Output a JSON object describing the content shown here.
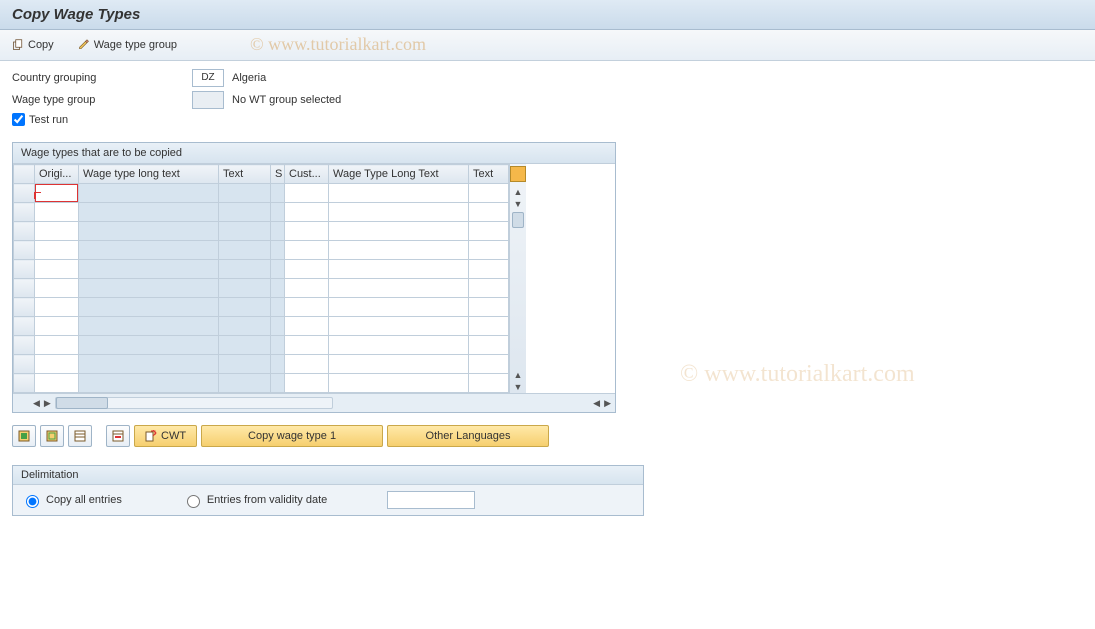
{
  "title": "Copy Wage Types",
  "toolbar": {
    "copy": "Copy",
    "wage_type_group_btn": "Wage type group"
  },
  "watermark": "© www.tutorialkart.com",
  "selection": {
    "country_grouping_label": "Country grouping",
    "country_grouping_code": "DZ",
    "country_grouping_text": "Algeria",
    "wage_type_group_label": "Wage type group",
    "wage_type_group_code": "",
    "wage_type_group_text": "No WT group selected",
    "test_run_label": "Test run",
    "test_run_checked": true
  },
  "grid": {
    "panel_title": "Wage types that are to be copied",
    "columns": {
      "origi": "Origi...",
      "long_text1": "Wage type long text",
      "text1": "Text",
      "s": "S",
      "cust": "Cust...",
      "long_text2": "Wage Type Long Text",
      "text2": "Text"
    },
    "row_count": 11
  },
  "buttons": {
    "cwt": "CWT",
    "copy_wt1": "Copy wage type 1",
    "other_lang": "Other Languages"
  },
  "delimitation": {
    "header": "Delimitation",
    "copy_all": "Copy all entries",
    "from_date": "Entries from validity date",
    "date_value": "",
    "selected": "copy_all"
  }
}
